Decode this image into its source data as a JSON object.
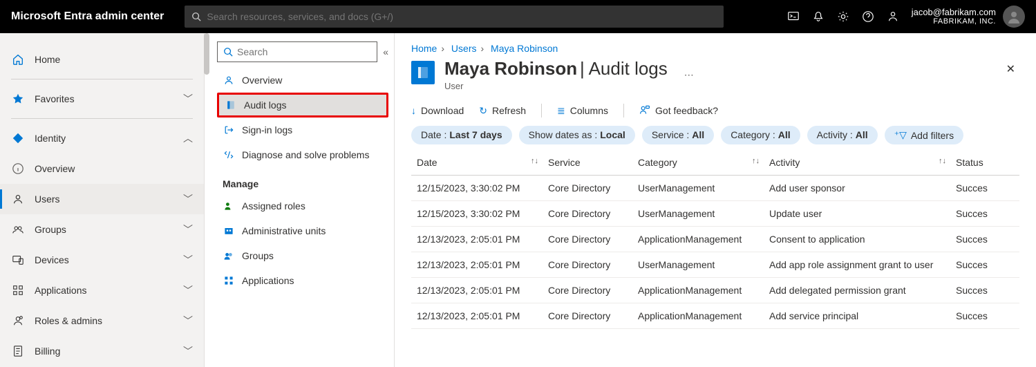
{
  "topbar": {
    "brand": "Microsoft Entra admin center",
    "search_placeholder": "Search resources, services, and docs (G+/)",
    "user_email": "jacob@fabrikam.com",
    "tenant": "FABRIKAM, INC."
  },
  "leftnav": {
    "items": [
      {
        "label": "Home",
        "icon": "home",
        "chev": false
      },
      {
        "divider": true
      },
      {
        "label": "Favorites",
        "icon": "star",
        "chev": "down"
      },
      {
        "divider": true
      },
      {
        "label": "Identity",
        "icon": "diamond",
        "chev": "up",
        "sectionHeader": true
      },
      {
        "label": "Overview",
        "icon": "info",
        "chev": false
      },
      {
        "label": "Users",
        "icon": "user",
        "chev": "down",
        "active": true
      },
      {
        "label": "Groups",
        "icon": "groups",
        "chev": "down"
      },
      {
        "label": "Devices",
        "icon": "devices",
        "chev": "down"
      },
      {
        "label": "Applications",
        "icon": "apps",
        "chev": "down"
      },
      {
        "label": "Roles & admins",
        "icon": "roles",
        "chev": "down"
      },
      {
        "label": "Billing",
        "icon": "billing",
        "chev": "down"
      }
    ]
  },
  "secnav": {
    "search_placeholder": "Search",
    "top": [
      {
        "label": "Overview",
        "icon": "person"
      },
      {
        "label": "Audit logs",
        "icon": "book",
        "selected": true,
        "highlighted": true
      },
      {
        "label": "Sign-in logs",
        "icon": "signin"
      },
      {
        "label": "Diagnose and solve problems",
        "icon": "diag"
      }
    ],
    "manage_heading": "Manage",
    "manage": [
      {
        "label": "Assigned roles",
        "icon": "roles2"
      },
      {
        "label": "Administrative units",
        "icon": "adminunits"
      },
      {
        "label": "Groups",
        "icon": "groups2"
      },
      {
        "label": "Applications",
        "icon": "apps2"
      }
    ]
  },
  "breadcrumb": {
    "home": "Home",
    "users": "Users",
    "current": "Maya Robinson"
  },
  "heading": {
    "title": "Maya Robinson",
    "suffix": "Audit logs",
    "kind": "User"
  },
  "toolbar": {
    "download": "Download",
    "refresh": "Refresh",
    "columns": "Columns",
    "feedback": "Got feedback?"
  },
  "filters": {
    "date_k": "Date : ",
    "date_v": "Last 7 days",
    "showdates_k": "Show dates as : ",
    "showdates_v": "Local",
    "service_k": "Service : ",
    "service_v": "All",
    "category_k": "Category : ",
    "category_v": "All",
    "activity_k": "Activity : ",
    "activity_v": "All",
    "add": "Add filters"
  },
  "table": {
    "headers": {
      "date": "Date",
      "service": "Service",
      "category": "Category",
      "activity": "Activity",
      "status": "Status"
    },
    "rows": [
      {
        "date": "12/15/2023, 3:30:02 PM",
        "service": "Core Directory",
        "category": "UserManagement",
        "activity": "Add user sponsor",
        "status": "Succes"
      },
      {
        "date": "12/15/2023, 3:30:02 PM",
        "service": "Core Directory",
        "category": "UserManagement",
        "activity": "Update user",
        "status": "Succes"
      },
      {
        "date": "12/13/2023, 2:05:01 PM",
        "service": "Core Directory",
        "category": "ApplicationManagement",
        "activity": "Consent to application",
        "status": "Succes"
      },
      {
        "date": "12/13/2023, 2:05:01 PM",
        "service": "Core Directory",
        "category": "UserManagement",
        "activity": "Add app role assignment grant to user",
        "status": "Succes"
      },
      {
        "date": "12/13/2023, 2:05:01 PM",
        "service": "Core Directory",
        "category": "ApplicationManagement",
        "activity": "Add delegated permission grant",
        "status": "Succes"
      },
      {
        "date": "12/13/2023, 2:05:01 PM",
        "service": "Core Directory",
        "category": "ApplicationManagement",
        "activity": "Add service principal",
        "status": "Succes"
      }
    ]
  }
}
